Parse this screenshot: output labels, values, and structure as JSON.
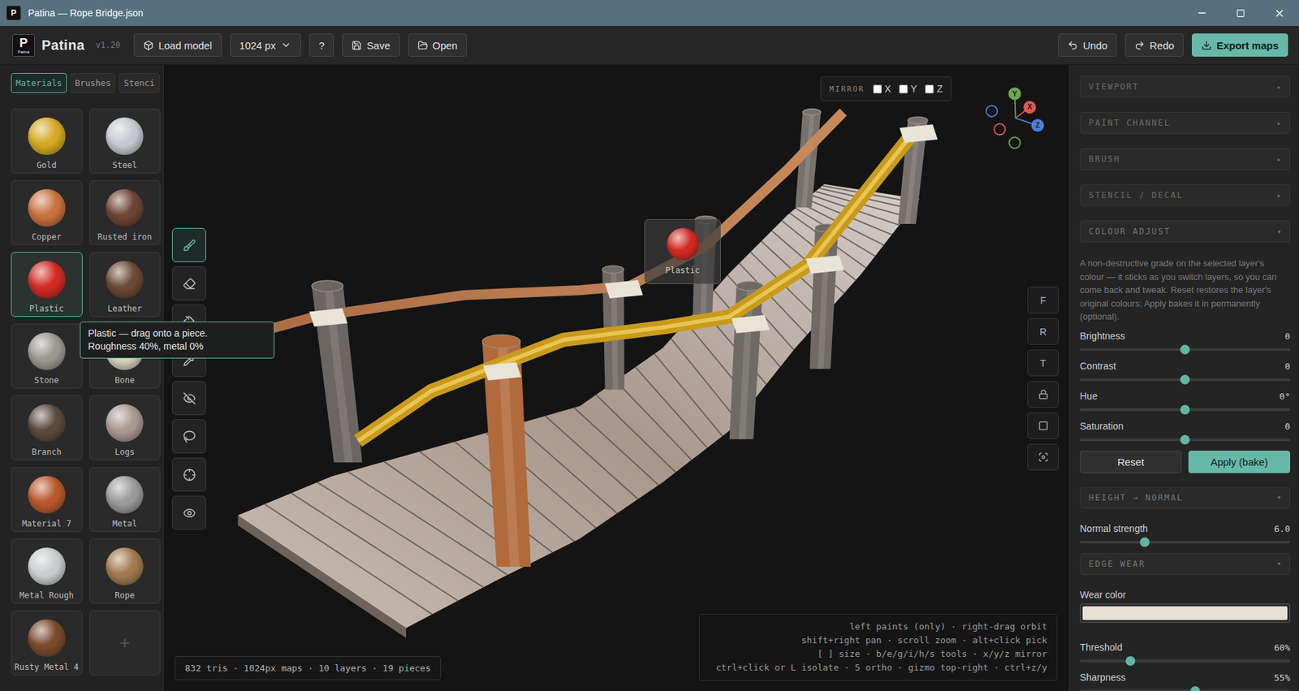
{
  "window": {
    "title": "Patina — Rope Bridge.json"
  },
  "app": {
    "logo": {
      "glyph": "P",
      "caption": "Patina"
    },
    "name": "Patina",
    "version": "v1.20"
  },
  "toolbar": {
    "left": [
      {
        "label": "Load model",
        "kind": "button"
      },
      {
        "label": "1024 px",
        "kind": "select"
      },
      {
        "label": "?",
        "kind": "button"
      },
      {
        "label": "Save",
        "kind": "button"
      },
      {
        "label": "Open",
        "kind": "button"
      }
    ],
    "right": [
      {
        "label": "Undo",
        "kind": "button"
      },
      {
        "label": "Redo",
        "kind": "button"
      },
      {
        "label": "Export maps",
        "kind": "primary"
      }
    ]
  },
  "sidebar": {
    "tabs": [
      {
        "label": "Materials",
        "selected": true
      },
      {
        "label": "Brushes",
        "selected": false
      },
      {
        "label": "Stenci",
        "selected": false
      }
    ],
    "materials": [
      {
        "kind": "material",
        "label": "Gold",
        "color": "#d4a820",
        "selected": false
      },
      {
        "kind": "material",
        "label": "Steel",
        "color": "#c4c8ce",
        "selected": false
      },
      {
        "kind": "material",
        "label": "Copper",
        "color": "#c8703e",
        "selected": false
      },
      {
        "kind": "material",
        "label": "Rusted iron",
        "color": "#6e4434",
        "selected": false
      },
      {
        "kind": "material",
        "label": "Plastic",
        "color": "#d02a22",
        "selected": true
      },
      {
        "kind": "material",
        "label": "Leather",
        "color": "#6a4a34",
        "selected": false
      },
      {
        "kind": "material",
        "label": "Stone",
        "color": "#9a9890",
        "selected": false
      },
      {
        "kind": "material",
        "label": "Bone",
        "color": "#d8d0bc",
        "selected": false
      },
      {
        "kind": "material",
        "label": "Branch",
        "color": "#5a4a3c",
        "selected": false
      },
      {
        "kind": "material",
        "label": "Logs",
        "color": "#a89890",
        "selected": false
      },
      {
        "kind": "material",
        "label": "Material 7",
        "color": "#b8582c",
        "selected": false
      },
      {
        "kind": "material",
        "label": "Metal",
        "color": "#9a9a9a",
        "selected": false
      },
      {
        "kind": "material",
        "label": "Metal Rough",
        "color": "#c8cccc",
        "selected": false
      },
      {
        "kind": "material",
        "label": "Rope",
        "color": "#a07a4c",
        "selected": false
      },
      {
        "kind": "material",
        "label": "Rusty Metal 4",
        "color": "#7a4a2c",
        "selected": false
      },
      {
        "kind": "add",
        "label": "+",
        "selected": false
      }
    ]
  },
  "tools": [
    {
      "selected": true
    },
    {
      "selected": false
    },
    {
      "selected": false
    },
    {
      "selected": false
    },
    {
      "selected": false
    },
    {
      "selected": false
    },
    {
      "selected": false
    },
    {
      "selected": false
    }
  ],
  "mirror": {
    "label": "MIRROR",
    "axes": [
      {
        "label": "X",
        "checked": false
      },
      {
        "label": "Y",
        "checked": false
      },
      {
        "label": "Z",
        "checked": false
      }
    ]
  },
  "gizmo": {
    "axes": [
      {
        "label": "Y",
        "color": "#6aa84f"
      },
      {
        "label": "X",
        "color": "#e0584f"
      },
      {
        "label": "Z",
        "color": "#4a7fe0"
      }
    ]
  },
  "view_buttons": [
    "F",
    "R",
    "T"
  ],
  "drag_ghost": {
    "label": "Plastic",
    "color": "#d02a22"
  },
  "tooltip": {
    "lines": [
      "Plastic — drag onto a piece.",
      "Roughness 40%, metal 0%"
    ]
  },
  "status": "832 tris · 1024px maps · 10 layers · 19 pieces",
  "hints": [
    "left paints (only) · right-drag orbit",
    "shift+right pan · scroll zoom · alt+click pick",
    "[ ] size · b/e/g/i/h/s tools · x/y/z mirror",
    "ctrl+click or L isolate · 5 ortho · gizmo top-right · ctrl+z/y"
  ],
  "panel": [
    {
      "kind": "header",
      "label": "VIEWPORT",
      "arrow": "▸",
      "expanded": false
    },
    {
      "kind": "header",
      "label": "PAINT CHANNEL",
      "arrow": "▸",
      "expanded": false
    },
    {
      "kind": "header",
      "label": "BRUSH",
      "arrow": "▸",
      "expanded": false
    },
    {
      "kind": "header",
      "label": "STENCIL / DECAL",
      "arrow": "▸",
      "expanded": false
    },
    {
      "kind": "header",
      "label": "COLOUR ADJUST",
      "arrow": "▾",
      "expanded": true
    },
    {
      "kind": "text",
      "text": "A non-destructive grade on the selected layer's colour — it sticks as you switch layers, so you can come back and tweak. Reset restores the layer's original colours; Apply bakes it in permanently (optional)."
    },
    {
      "kind": "slider",
      "label": "Brightness",
      "value": "0",
      "level": 0.5
    },
    {
      "kind": "slider",
      "label": "Contrast",
      "value": "0",
      "level": 0.5
    },
    {
      "kind": "slider",
      "label": "Hue",
      "value": "0°",
      "level": 0.5
    },
    {
      "kind": "slider",
      "label": "Saturation",
      "value": "0",
      "level": 0.5
    },
    {
      "kind": "buttons",
      "buttons": [
        {
          "label": "Reset",
          "primary": false
        },
        {
          "label": "Apply (bake)",
          "primary": true
        }
      ]
    },
    {
      "kind": "header",
      "label": "HEIGHT → NORMAL",
      "arrow": "▾",
      "expanded": true
    },
    {
      "kind": "slider",
      "label": "Normal strength",
      "value": "6.0",
      "level": 0.31
    },
    {
      "kind": "header",
      "label": "EDGE WEAR",
      "arrow": "▾",
      "expanded": true
    },
    {
      "kind": "color",
      "label": "Wear color",
      "color": "#e8e0d4"
    },
    {
      "kind": "slider",
      "label": "Threshold",
      "value": "60%",
      "level": 0.24
    },
    {
      "kind": "slider",
      "label": "Sharpness",
      "value": "55%",
      "level": 0.55
    }
  ]
}
